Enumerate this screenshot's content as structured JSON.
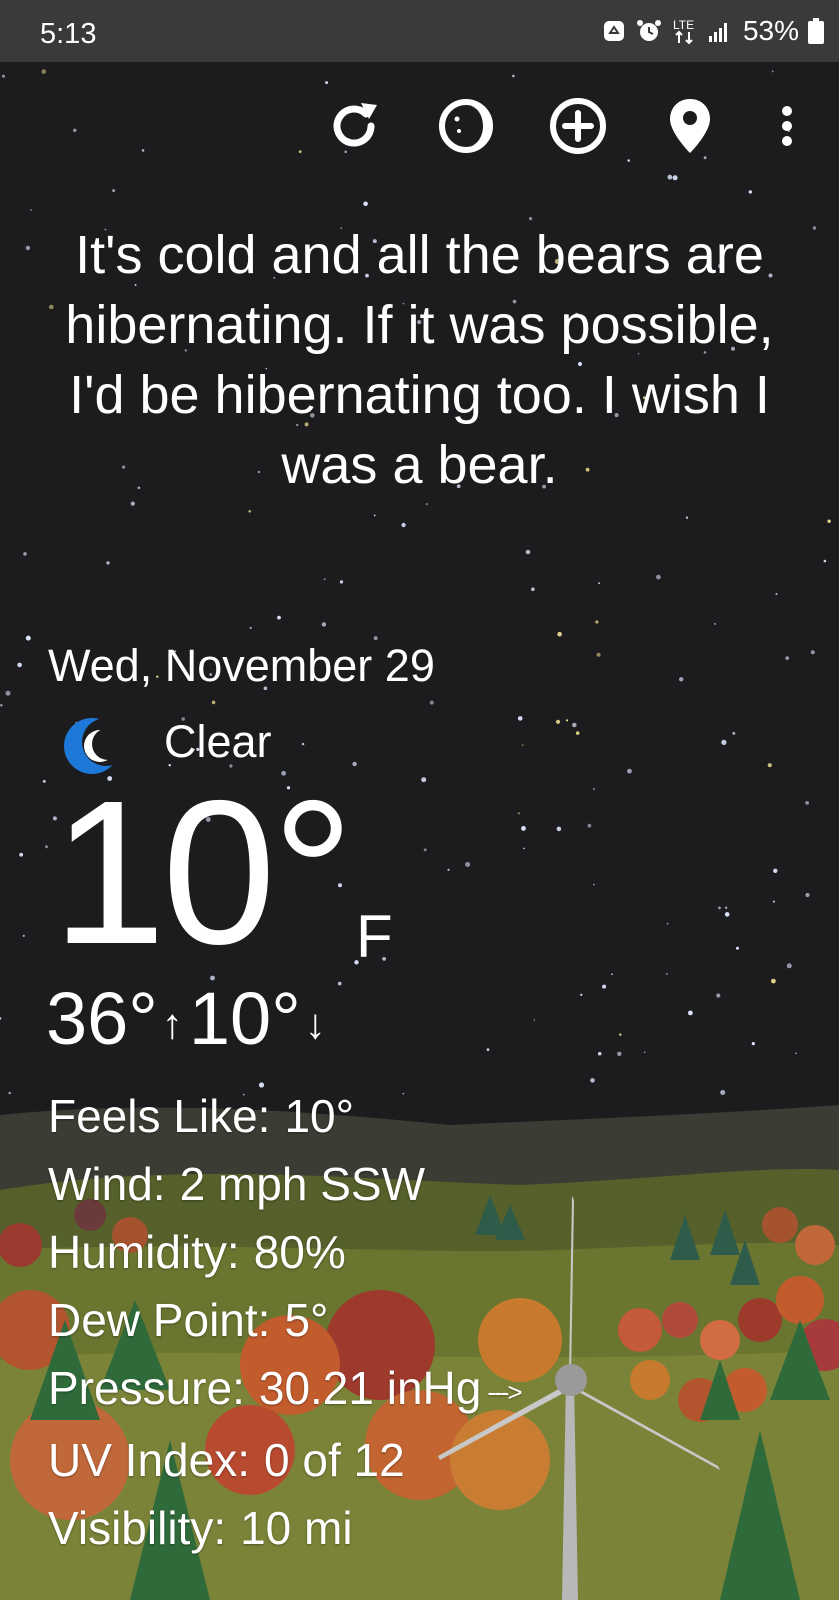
{
  "status_bar": {
    "time": "5:13",
    "network": "LTE",
    "battery": "53%"
  },
  "toolbar": {
    "icons": [
      "refresh-icon",
      "moon-phase-icon",
      "add-location-icon",
      "location-pin-icon",
      "more-options-icon"
    ]
  },
  "quote": "It's cold and all the bears are hibernating. If it was possible, I'd be hibernating too. I wish I was a bear.",
  "weather": {
    "date": "Wed, November 29",
    "condition": "Clear",
    "condition_icon": "crescent-moon-icon",
    "temperature": "10°",
    "unit": "F",
    "high": "36°",
    "high_arrow": "↑",
    "low": "10°",
    "low_arrow": "↓"
  },
  "details": {
    "feels_like": {
      "label": "Feels Like:",
      "value": "10°"
    },
    "wind": {
      "label": "Wind:",
      "value": "2 mph SSW"
    },
    "humidity": {
      "label": "Humidity:",
      "value": "80%"
    },
    "dew_point": {
      "label": "Dew Point:",
      "value": "5°"
    },
    "pressure": {
      "label": "Pressure:",
      "value": "30.21 inHg",
      "trend": "--->"
    },
    "uv_index": {
      "label": "UV Index:",
      "value": "0 of 12"
    },
    "visibility": {
      "label": "Visibility:",
      "value": "10 mi"
    }
  },
  "colors": {
    "sky": "#1c1c1e",
    "status_bar": "#3a3a3c",
    "moon_icon": "#1e78d8",
    "hills": "#5d6a2a"
  }
}
